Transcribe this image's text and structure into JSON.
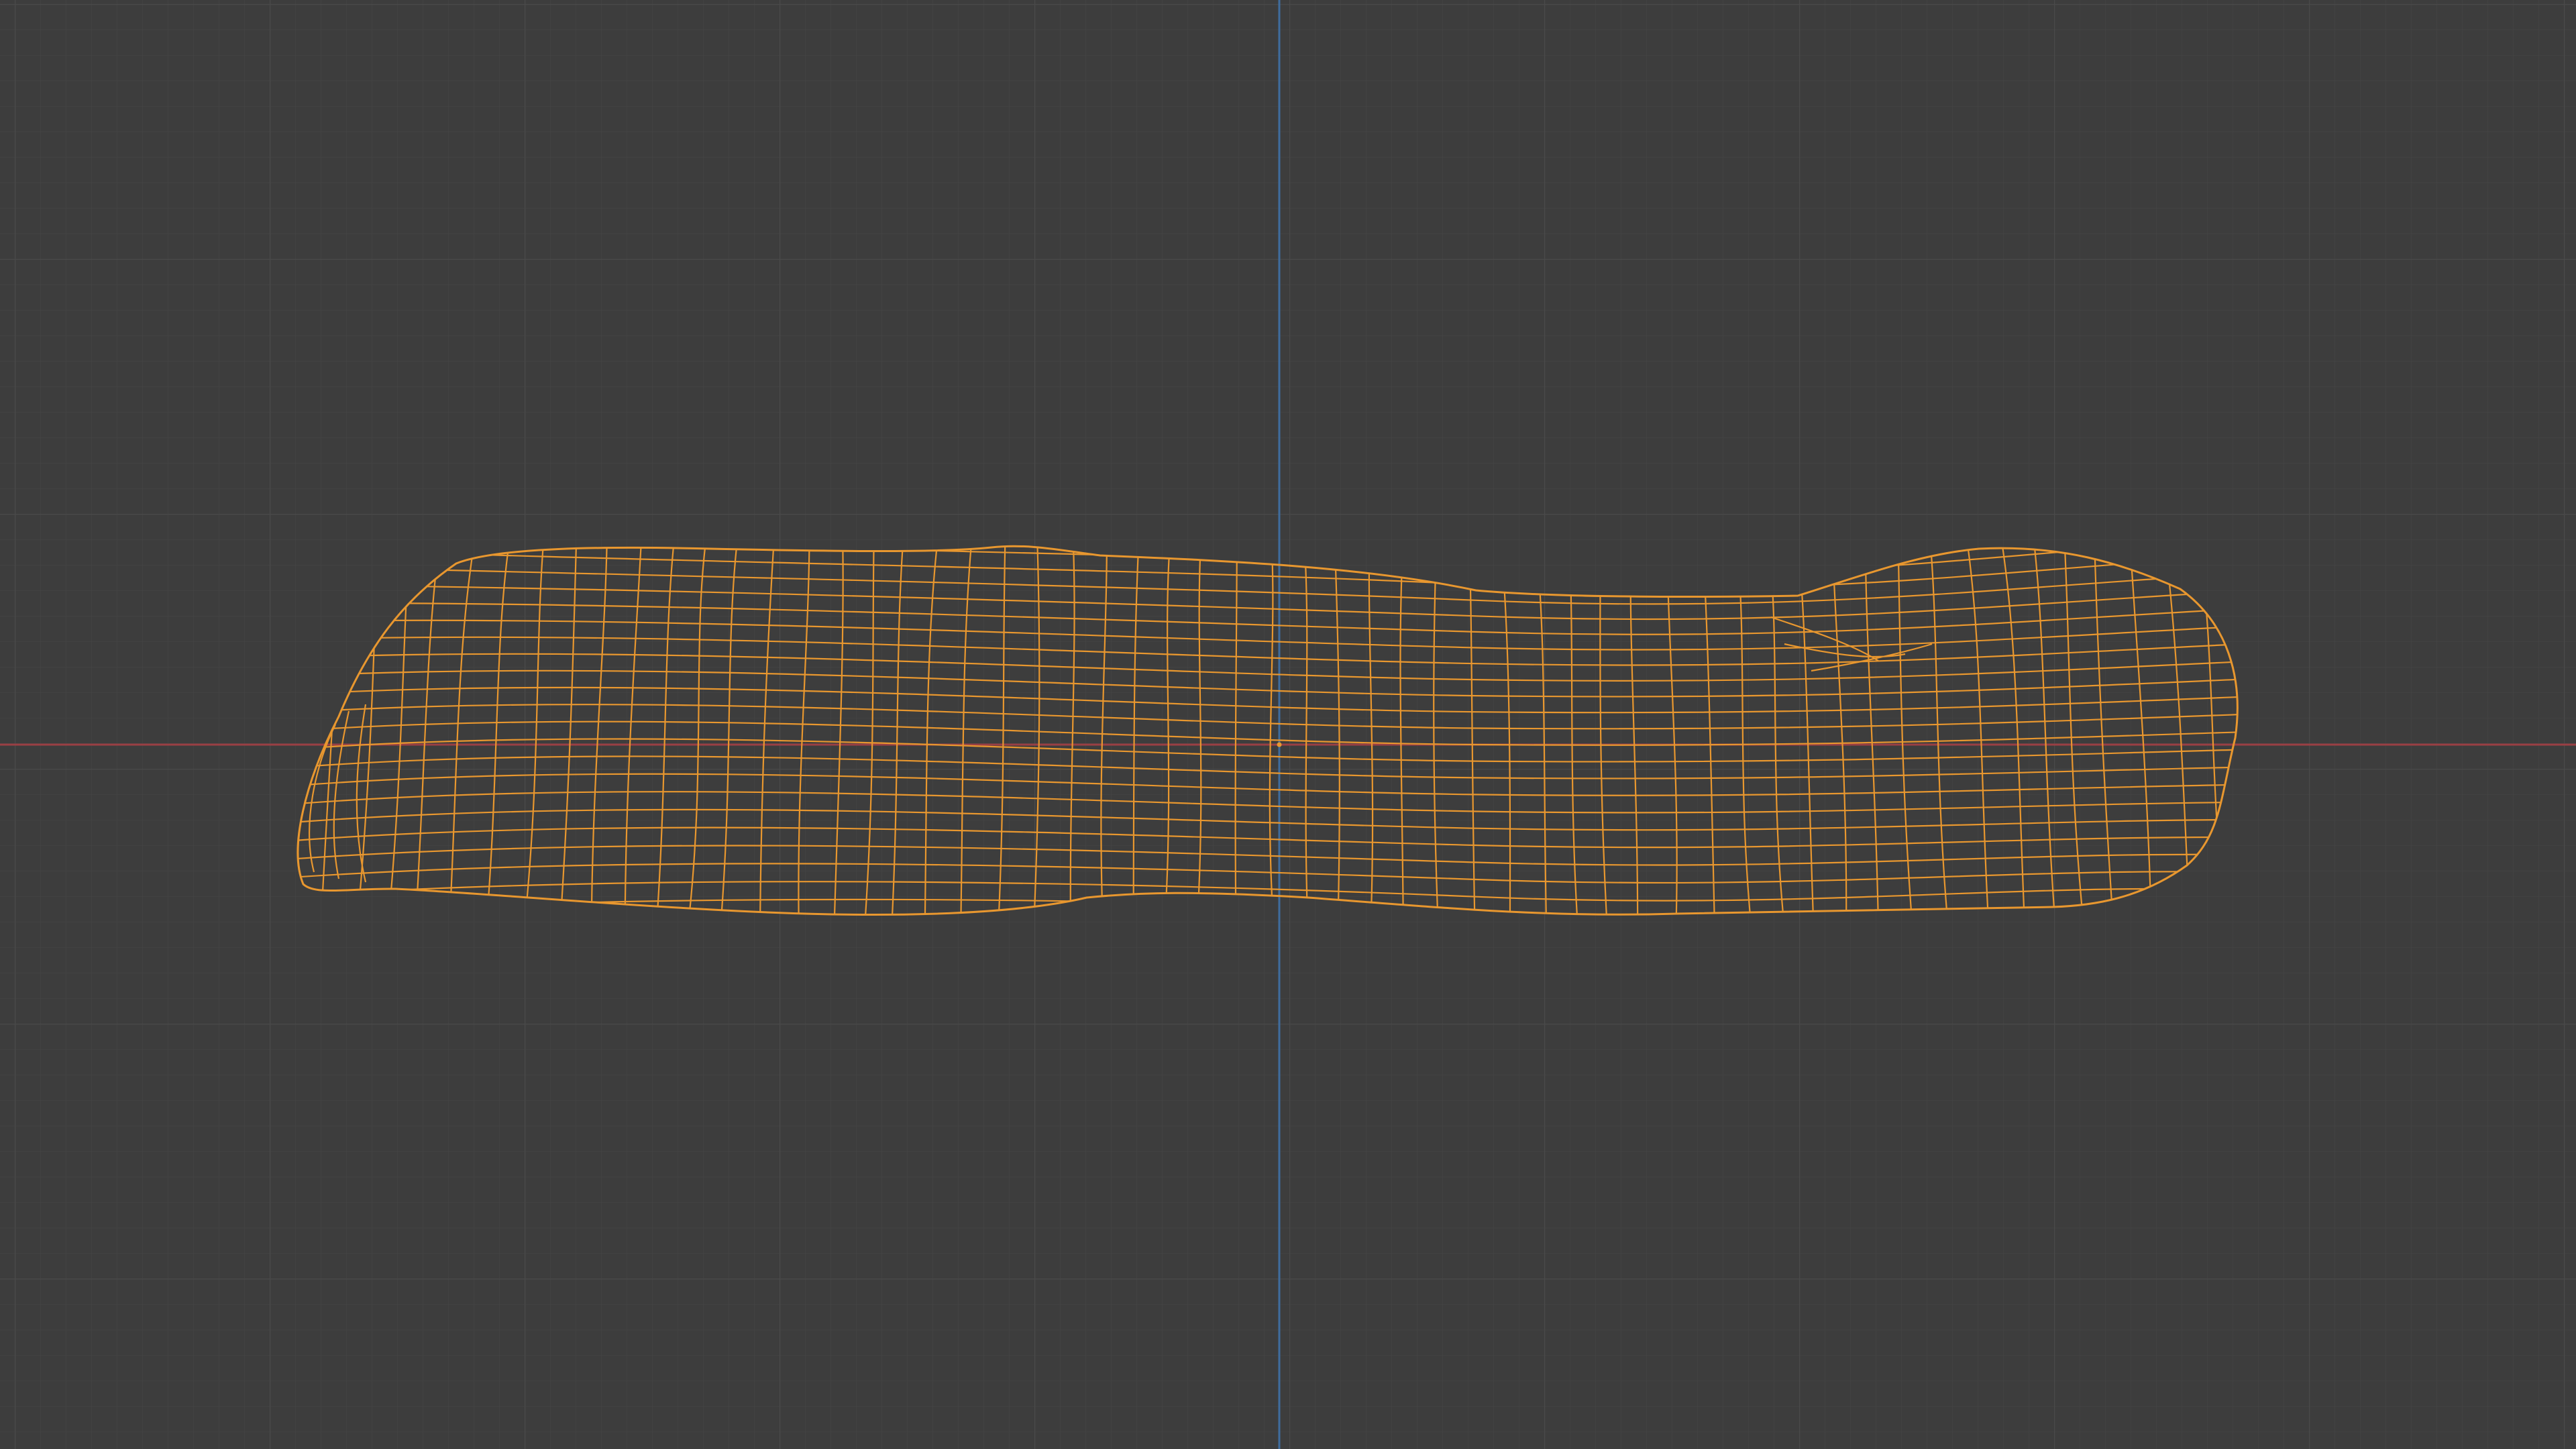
{
  "viewport": {
    "view": "wireframe",
    "background_color": "#3d3d3d",
    "grid": {
      "visible": true,
      "minor_color": "#434343",
      "major_color": "#4a4a4a"
    },
    "axes": {
      "x_axis_color": "#9a3f44",
      "y_axis_color": "#3f6d9e"
    },
    "object": {
      "type": "mesh",
      "display": "wireframe",
      "selected": true,
      "wire_color": "#e8972f"
    },
    "origin_dot_color": "#e8972f"
  }
}
